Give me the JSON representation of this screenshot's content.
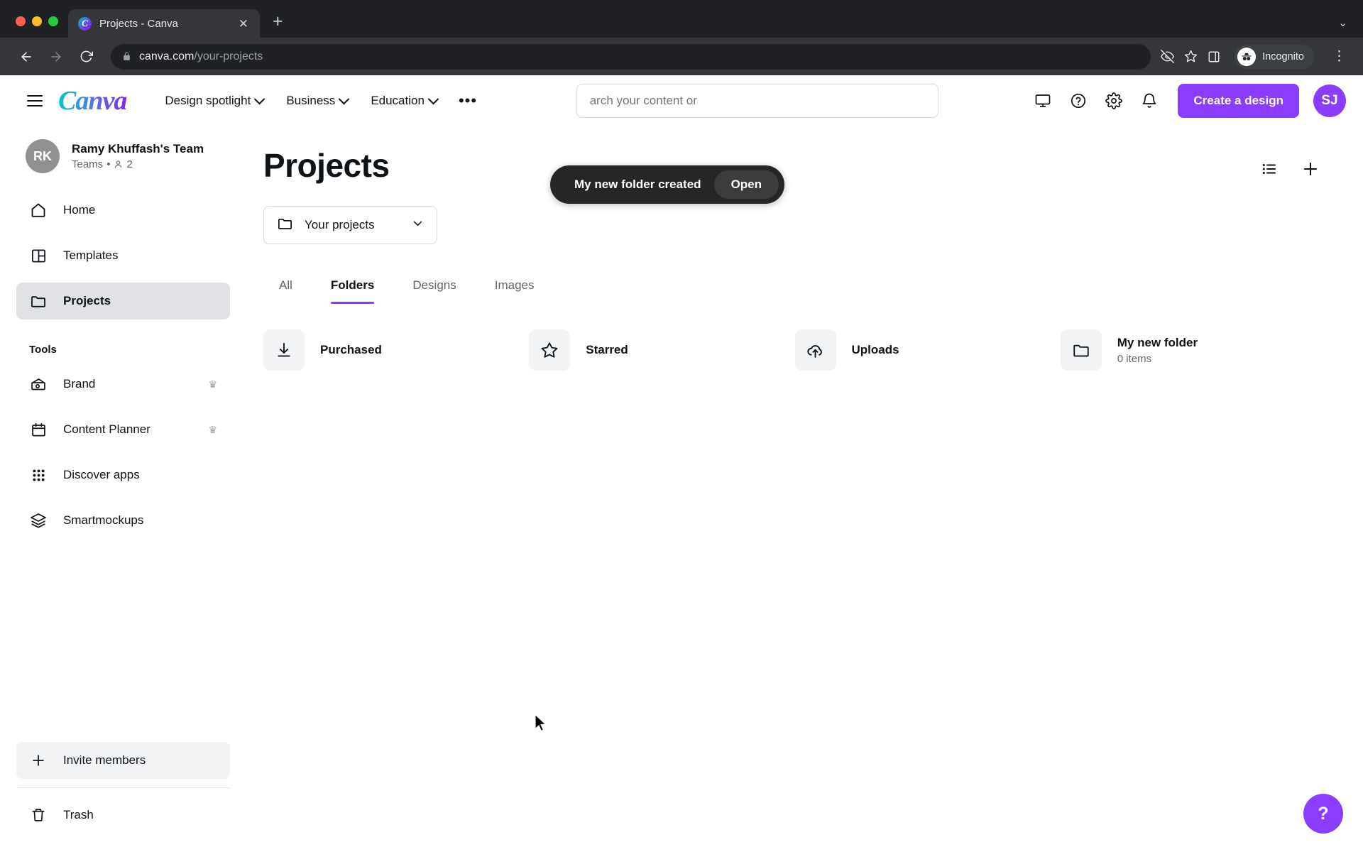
{
  "browser": {
    "tab": {
      "title": "Projects - Canva",
      "favicon": "canva-favicon",
      "close": "✕"
    },
    "new_tab": "+",
    "tabstrip_chevron": "⌄",
    "url": {
      "host": "canva.com",
      "path": "/your-projects",
      "lock": "lock-icon"
    },
    "profile_label": "Incognito",
    "nav": {
      "back": "back-icon",
      "forward": "forward-icon",
      "reload": "reload-icon"
    },
    "toolbar_icons": [
      "eye-off-icon",
      "star-icon",
      "side-panel-icon"
    ],
    "menu": "⋮"
  },
  "topnav": {
    "logo": "Canva",
    "menu_icon": "hamburger-icon",
    "links": [
      {
        "label": "Design spotlight",
        "caret": true
      },
      {
        "label": "Business",
        "caret": true
      },
      {
        "label": "Education",
        "caret": true
      }
    ],
    "more": "•••",
    "search": {
      "placeholder": "arch your content or"
    },
    "icons": [
      "desktop-icon",
      "help-circle-icon",
      "settings-gear-icon",
      "bell-icon"
    ],
    "create_label": "Create a design",
    "avatar_initials": "SJ"
  },
  "toast": {
    "message": "My new folder created",
    "action_label": "Open"
  },
  "sidebar": {
    "team": {
      "initials": "RK",
      "name": "Ramy Khuffash's Team",
      "meta_prefix": "Teams",
      "separator": "•",
      "member_icon": "person-icon",
      "member_count": "2"
    },
    "items": [
      {
        "label": "Home",
        "icon": "home-icon",
        "active": false
      },
      {
        "label": "Templates",
        "icon": "templates-icon",
        "active": false
      },
      {
        "label": "Projects",
        "icon": "folder-icon",
        "active": true
      }
    ],
    "tools_label": "Tools",
    "tools": [
      {
        "label": "Brand",
        "icon": "brand-icon",
        "pro": "♛"
      },
      {
        "label": "Content Planner",
        "icon": "calendar-icon",
        "pro": "♛"
      },
      {
        "label": "Discover apps",
        "icon": "apps-grid-icon",
        "pro": ""
      },
      {
        "label": "Smartmockups",
        "icon": "layers-icon",
        "pro": ""
      }
    ],
    "invite_label": "Invite members",
    "invite_icon": "plus-icon",
    "trash_label": "Trash",
    "trash_icon": "trash-icon"
  },
  "main": {
    "title": "Projects",
    "view_toggle_icon": "list-view-icon",
    "add_icon": "plus-icon",
    "filter": {
      "label": "Your projects",
      "icon": "folder-icon",
      "caret": "chevron-down-icon"
    },
    "tabs": [
      {
        "label": "All",
        "active": false
      },
      {
        "label": "Folders",
        "active": true
      },
      {
        "label": "Designs",
        "active": false
      },
      {
        "label": "Images",
        "active": false
      }
    ],
    "cards": [
      {
        "title": "Purchased",
        "subtitle": "",
        "icon": "download-icon"
      },
      {
        "title": "Starred",
        "subtitle": "",
        "icon": "star-outline-icon"
      },
      {
        "title": "Uploads",
        "subtitle": "",
        "icon": "cloud-upload-icon"
      },
      {
        "title": "My new folder",
        "subtitle": "0 items",
        "icon": "folder-icon"
      }
    ],
    "help_fab": "?"
  },
  "colors": {
    "accent_purple": "#8B3DFF",
    "chrome_dark": "#202124",
    "toast_bg": "#252627"
  }
}
